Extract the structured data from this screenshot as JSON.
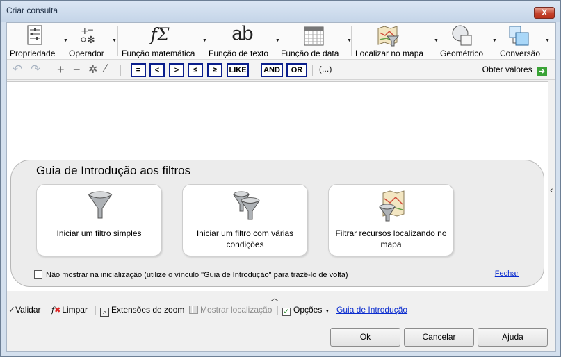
{
  "window": {
    "title": "Criar consulta",
    "close_glyph": "X"
  },
  "ribbon": {
    "items": [
      {
        "label": "Propriedade",
        "icon": "property-list-icon"
      },
      {
        "label": "Operador",
        "icon": "operator-icon"
      },
      {
        "label": "Função matemática",
        "icon": "math-function-icon",
        "glyph": "fΣ"
      },
      {
        "label": "Função de texto",
        "icon": "text-function-icon",
        "glyph": "ab"
      },
      {
        "label": "Função de data",
        "icon": "calendar-icon"
      },
      {
        "label": "Localizar no mapa",
        "icon": "map-filter-icon"
      },
      {
        "label": "Geométrico",
        "icon": "geometry-icon"
      },
      {
        "label": "Conversão",
        "icon": "conversion-icon"
      }
    ]
  },
  "toolbar2": {
    "operators": [
      "=",
      "<",
      ">",
      "≤",
      "≥",
      "LIKE"
    ],
    "logical": [
      "AND",
      "OR"
    ],
    "parens": "(…)",
    "obter_valores": "Obter valores"
  },
  "guide": {
    "title": "Guia de Introdução aos filtros",
    "cards": [
      {
        "label": "Iniciar um filtro simples",
        "icon": "funnel-icon"
      },
      {
        "label": "Iniciar um filtro com várias condições",
        "icon": "double-funnel-icon"
      },
      {
        "label": "Filtrar recursos localizando no mapa",
        "icon": "map-funnel-icon"
      }
    ],
    "checkbox_label": "Não mostrar na inicialização (utilize o vínculo \"Guia de Introdução\" para trazê-lo de volta)",
    "close_link": "Fechar"
  },
  "bottom": {
    "validar": "Validar",
    "limpar": "Limpar",
    "zoom": "Extensões de zoom",
    "mostrar": "Mostrar localização",
    "opcoes": "Opções",
    "guia": "Guia de Introdução"
  },
  "buttons": {
    "ok": "Ok",
    "cancel": "Cancelar",
    "help": "Ajuda"
  }
}
